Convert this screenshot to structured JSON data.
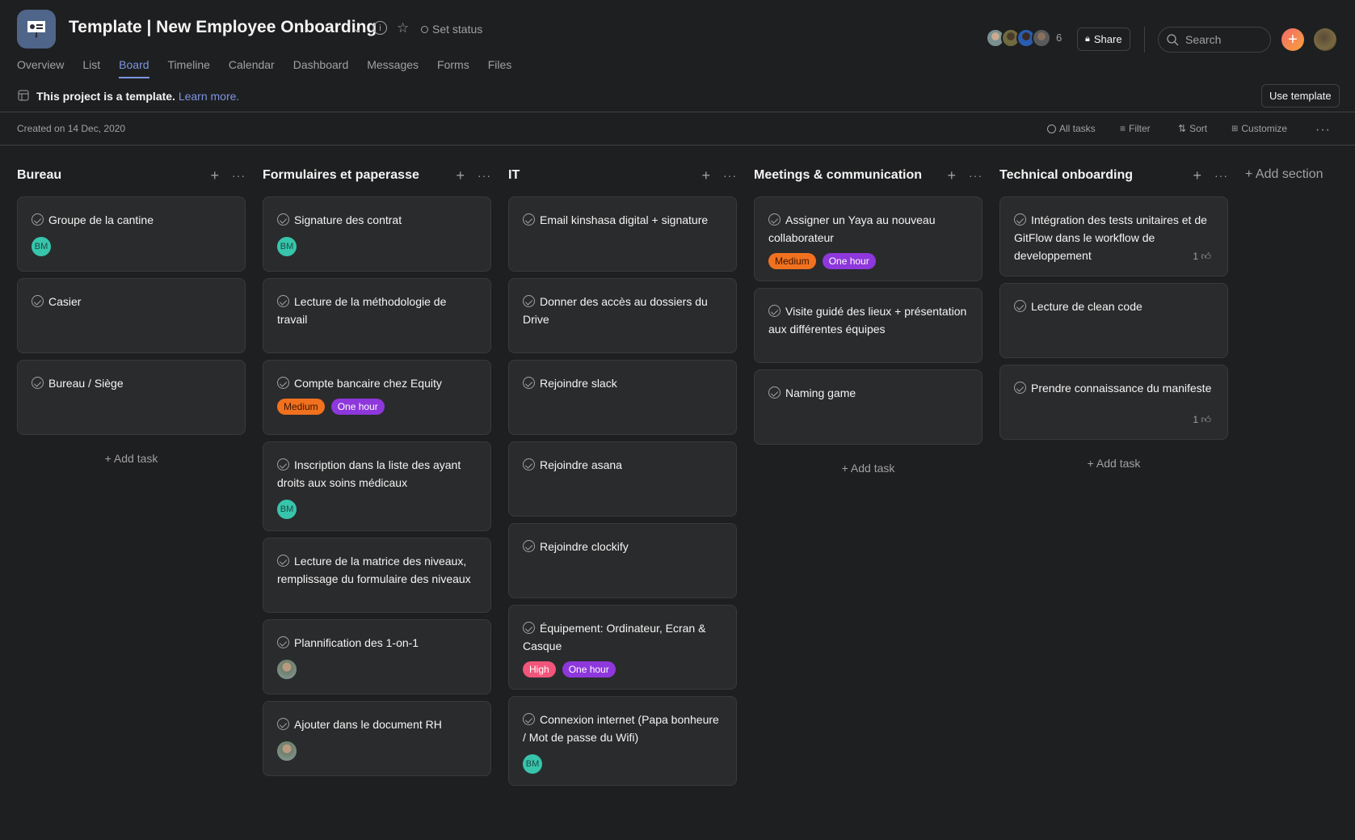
{
  "header": {
    "project_title": "Template | New Employee Onboarding",
    "project_icon": "presentation-icon",
    "set_status": "Set status",
    "member_count": "6",
    "share_label": "Share",
    "search_placeholder": "Search"
  },
  "tabs": [
    {
      "label": "Overview"
    },
    {
      "label": "List"
    },
    {
      "label": "Board",
      "active": true
    },
    {
      "label": "Timeline"
    },
    {
      "label": "Calendar"
    },
    {
      "label": "Dashboard"
    },
    {
      "label": "Messages"
    },
    {
      "label": "Forms"
    },
    {
      "label": "Files"
    }
  ],
  "banner": {
    "text": "This project is a template.",
    "link": "Learn more.",
    "use_template": "Use template"
  },
  "toolbar": {
    "created": "Created on 14 Dec, 2020",
    "all_tasks": "All tasks",
    "filter": "Filter",
    "sort": "Sort",
    "customize": "Customize"
  },
  "board": {
    "add_task": "+ Add task",
    "add_section": "+ Add section",
    "columns": [
      {
        "title": "Bureau",
        "show_add_task": true,
        "cards": [
          {
            "title": "Groupe de la cantine",
            "assignee": "BM"
          },
          {
            "title": "Casier"
          },
          {
            "title": "Bureau / Siège"
          }
        ]
      },
      {
        "title": "Formulaires et paperasse",
        "show_add_task": false,
        "cards": [
          {
            "title": "Signature des contrat",
            "assignee": "BM"
          },
          {
            "title": "Lecture de la méthodologie de travail"
          },
          {
            "title": "Compte bancaire chez Equity",
            "tags": [
              "Medium",
              "One hour"
            ]
          },
          {
            "title": "Inscription dans la liste des ayant droits aux soins médicaux",
            "assignee": "BM"
          },
          {
            "title": "Lecture de la matrice des niveaux, remplissage du formulaire des niveaux"
          },
          {
            "title": "Plannification des 1-on-1",
            "assignee": "photo"
          },
          {
            "title": "Ajouter dans le document RH",
            "assignee": "photo"
          }
        ]
      },
      {
        "title": "IT",
        "show_add_task": false,
        "cards": [
          {
            "title": "Email kinshasa digital + signature"
          },
          {
            "title": "Donner des accès au dossiers du Drive"
          },
          {
            "title": "Rejoindre slack"
          },
          {
            "title": "Rejoindre asana"
          },
          {
            "title": "Rejoindre clockify"
          },
          {
            "title": "Équipement: Ordinateur, Ecran & Casque",
            "tags": [
              "High",
              "One hour"
            ]
          },
          {
            "title": "Connexion internet (Papa bonheure / Mot de passe du Wifi)",
            "assignee": "BM"
          }
        ]
      },
      {
        "title": "Meetings & communication",
        "show_add_task": true,
        "cards": [
          {
            "title": "Assigner un Yaya au nouveau collaborateur",
            "tags": [
              "Medium",
              "One hour"
            ]
          },
          {
            "title": "Visite guidé des lieux + présentation aux différentes équipes"
          },
          {
            "title": "Naming game"
          }
        ]
      },
      {
        "title": "Technical onboarding",
        "show_add_task": true,
        "cards": [
          {
            "title": "Intégration des tests unitaires et de GitFlow dans le workflow de developpement",
            "likes": "1"
          },
          {
            "title": "Lecture de clean code"
          },
          {
            "title": "Prendre connaissance du manifeste",
            "likes": "1"
          }
        ]
      }
    ]
  },
  "colors": {
    "background": "#1e1f21",
    "card": "#2a2b2d",
    "accent": "#7d95e0",
    "medium": "#f1711f",
    "high": "#f2557a",
    "one_hour": "#8d37dc",
    "bm_avatar": "#37c5ab"
  }
}
